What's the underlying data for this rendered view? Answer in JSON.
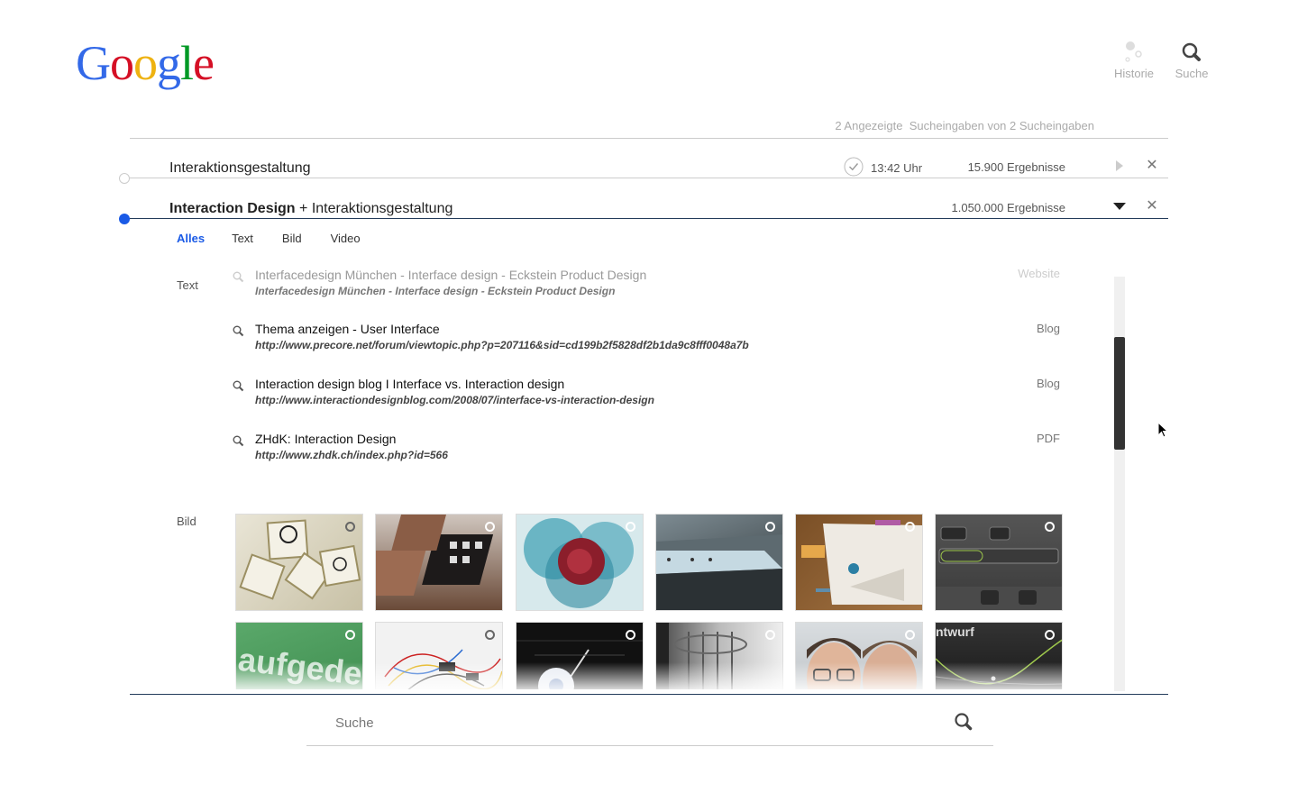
{
  "logo": {
    "letters": [
      "G",
      "o",
      "o",
      "g",
      "l",
      "e"
    ],
    "colors": [
      "#3369e8",
      "#d50f25",
      "#eeb211",
      "#3369e8",
      "#009925",
      "#d50f25"
    ]
  },
  "nav": {
    "history_label": "Historie",
    "search_label": "Suche"
  },
  "summary": "2 Angezeigte  Sucheingaben von 2 Sucheingaben",
  "queries": [
    {
      "text": "Interaktionsgestaltung",
      "time": "13:42 Uhr",
      "count": "15.900 Ergebnisse"
    },
    {
      "bold": "Interaction Design",
      "rest": " + Interaktionsgestaltung",
      "count": "1.050.000 Ergebnisse"
    }
  ],
  "tabs": [
    "Alles",
    "Text",
    "Bild",
    "Video"
  ],
  "sections": {
    "text": "Text",
    "image": "Bild"
  },
  "results": [
    {
      "title": "Interfacedesign München - Interface design - Eckstein Product Design",
      "url": "Interfacedesign München - Interface design - Eckstein Product Design",
      "type": "Website"
    },
    {
      "title": "Thema anzeigen - User Interface",
      "url": "http://www.precore.net/forum/viewtopic.php?p=207116&sid=cd199b2f5828df2b1da9c8fff0048a7b",
      "type": "Blog"
    },
    {
      "title": "Interaction design blog I Interface vs. Interaction design",
      "url": "http://www.interactiondesignblog.com/2008/07/interface-vs-interaction-design",
      "type": "Blog"
    },
    {
      "title": "ZHdK: Interaction Design",
      "url": "http://www.zhdk.ch/index.php?id=566",
      "type": "PDF"
    }
  ],
  "image_text": {
    "green": "aufgede",
    "dark": "ntwurf"
  },
  "search": {
    "placeholder": "Suche"
  },
  "colors": {
    "accent": "#1a5ae6",
    "divider": "#233b5a"
  }
}
